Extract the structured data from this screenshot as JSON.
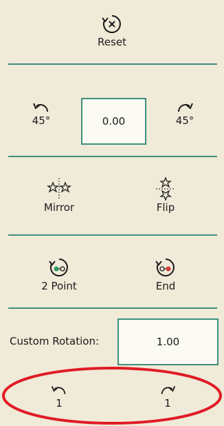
{
  "reset": {
    "label": "Reset",
    "icon": "reset-icon"
  },
  "rotate": {
    "left_label": "45°",
    "right_label": "45°",
    "angle_value": "0.00"
  },
  "mirror": {
    "label": "Mirror"
  },
  "flip": {
    "label": "Flip"
  },
  "two_point": {
    "label": "2 Point"
  },
  "end": {
    "label": "End"
  },
  "custom_rotation": {
    "label": "Custom Rotation:",
    "value": "1.00"
  },
  "step": {
    "left_label": "1",
    "right_label": "1"
  },
  "colors": {
    "background": "#f0ead9",
    "divider": "#3f8f7c",
    "highlight": "#e01b24",
    "green_dot": "#2e9a6a",
    "red_dot": "#d23a3a"
  }
}
